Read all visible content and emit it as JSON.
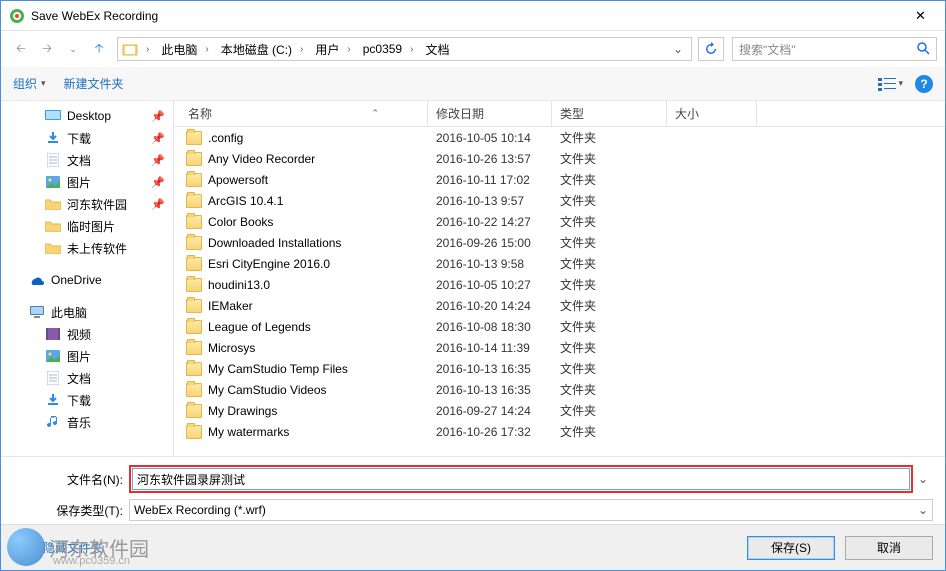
{
  "window": {
    "title": "Save WebEx Recording"
  },
  "breadcrumb": [
    "此电脑",
    "本地磁盘 (C:)",
    "用户",
    "pc0359",
    "文档"
  ],
  "search": {
    "placeholder": "搜索\"文档\""
  },
  "toolbar": {
    "organize": "组织",
    "newfolder": "新建文件夹"
  },
  "columns": {
    "name": "名称",
    "date": "修改日期",
    "type": "类型",
    "size": "大小"
  },
  "sidebar": {
    "quick": [
      {
        "label": "Desktop",
        "icon": "desktop",
        "pinned": true
      },
      {
        "label": "下载",
        "icon": "dl",
        "pinned": true
      },
      {
        "label": "文档",
        "icon": "doc",
        "pinned": true
      },
      {
        "label": "图片",
        "icon": "pic",
        "pinned": true
      },
      {
        "label": "河东软件园",
        "icon": "folder",
        "pinned": true
      },
      {
        "label": "临时图片",
        "icon": "folder",
        "pinned": false
      },
      {
        "label": "未上传软件",
        "icon": "folder",
        "pinned": false
      }
    ],
    "onedrive": {
      "label": "OneDrive"
    },
    "thispc": {
      "label": "此电脑"
    },
    "thispc_items": [
      {
        "label": "视频",
        "icon": "video"
      },
      {
        "label": "图片",
        "icon": "pic"
      },
      {
        "label": "文档",
        "icon": "doc"
      },
      {
        "label": "下载",
        "icon": "dl"
      },
      {
        "label": "音乐",
        "icon": "music"
      }
    ]
  },
  "files": [
    {
      "name": ".config",
      "date": "2016-10-05 10:14",
      "type": "文件夹"
    },
    {
      "name": "Any Video Recorder",
      "date": "2016-10-26 13:57",
      "type": "文件夹"
    },
    {
      "name": "Apowersoft",
      "date": "2016-10-11 17:02",
      "type": "文件夹"
    },
    {
      "name": "ArcGIS 10.4.1",
      "date": "2016-10-13 9:57",
      "type": "文件夹"
    },
    {
      "name": "Color Books",
      "date": "2016-10-22 14:27",
      "type": "文件夹"
    },
    {
      "name": "Downloaded Installations",
      "date": "2016-09-26 15:00",
      "type": "文件夹"
    },
    {
      "name": "Esri CityEngine 2016.0",
      "date": "2016-10-13 9:58",
      "type": "文件夹"
    },
    {
      "name": "houdini13.0",
      "date": "2016-10-05 10:27",
      "type": "文件夹"
    },
    {
      "name": "IEMaker",
      "date": "2016-10-20 14:24",
      "type": "文件夹"
    },
    {
      "name": "League of Legends",
      "date": "2016-10-08 18:30",
      "type": "文件夹"
    },
    {
      "name": "Microsys",
      "date": "2016-10-14 11:39",
      "type": "文件夹"
    },
    {
      "name": "My CamStudio Temp Files",
      "date": "2016-10-13 16:35",
      "type": "文件夹"
    },
    {
      "name": "My CamStudio Videos",
      "date": "2016-10-13 16:35",
      "type": "文件夹"
    },
    {
      "name": "My Drawings",
      "date": "2016-09-27 14:24",
      "type": "文件夹"
    },
    {
      "name": "My watermarks",
      "date": "2016-10-26 17:32",
      "type": "文件夹"
    }
  ],
  "form": {
    "filename_label": "文件名(N):",
    "filename_value": "河东软件园录屏测试",
    "filetype_label": "保存类型(T):",
    "filetype_value": "WebEx Recording (*.wrf)"
  },
  "footer": {
    "hide": "隐藏文件夹",
    "save": "保存(S)",
    "cancel": "取消"
  },
  "watermark": {
    "brand": "河东软件园",
    "url": "www.pc0359.cn"
  }
}
